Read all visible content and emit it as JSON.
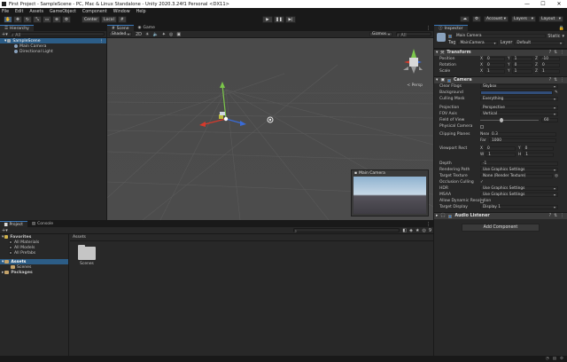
{
  "window": {
    "title": "First Project - SampleScene - PC, Mac & Linux Standalone - Unity 2020.3.24f1 Personal <DX11>",
    "minimize": "—",
    "maximize": "☐",
    "close": "✕"
  },
  "menu": [
    "File",
    "Edit",
    "Assets",
    "GameObject",
    "Component",
    "Window",
    "Help"
  ],
  "toolbar": {
    "pivot": "Center",
    "space": "Local",
    "account": "Account",
    "layers": "Layers",
    "layout": "Layout"
  },
  "hierarchy": {
    "tab": "Hierarchy",
    "search_placeholder": "All",
    "scene": "SampleScene",
    "items": [
      "Main Camera",
      "Directional Light"
    ]
  },
  "scene_view": {
    "tab_scene": "Scene",
    "tab_game": "Game",
    "shading": "Shaded",
    "mode_2d": "2D",
    "gizmos": "Gizmos",
    "search_placeholder": "All",
    "persp": "< Persp",
    "preview_title": "Main Camera"
  },
  "inspector": {
    "tab": "Inspector",
    "object_name": "Main Camera",
    "static": "Static",
    "tag_label": "Tag",
    "tag": "MainCamera",
    "layer_label": "Layer",
    "layer": "Default",
    "transform": {
      "title": "Transform",
      "position": {
        "label": "Position",
        "x": "0",
        "y": "1",
        "z": "-10"
      },
      "rotation": {
        "label": "Rotation",
        "x": "0",
        "y": "0",
        "z": "0"
      },
      "scale": {
        "label": "Scale",
        "x": "1",
        "y": "1",
        "z": "1"
      }
    },
    "camera": {
      "title": "Camera",
      "clear_flags": {
        "label": "Clear Flags",
        "value": "Skybox"
      },
      "background": {
        "label": "Background",
        "color": "#314d79"
      },
      "culling_mask": {
        "label": "Culling Mask",
        "value": "Everything"
      },
      "projection": {
        "label": "Projection",
        "value": "Perspective"
      },
      "fov_axis": {
        "label": "FOV Axis",
        "value": "Vertical"
      },
      "field_of_view": {
        "label": "Field of View",
        "value": "60"
      },
      "physical_camera": {
        "label": "Physical Camera"
      },
      "clipping_planes": {
        "label": "Clipping Planes",
        "near_label": "Near",
        "near": "0.3",
        "far_label": "Far",
        "far": "1000"
      },
      "viewport_rect": {
        "label": "Viewport Rect",
        "x": "0",
        "y": "0",
        "w": "1",
        "h": "1"
      },
      "depth": {
        "label": "Depth",
        "value": "-1"
      },
      "rendering_path": {
        "label": "Rendering Path",
        "value": "Use Graphics Settings"
      },
      "target_texture": {
        "label": "Target Texture",
        "value": "None (Render Texture)"
      },
      "occlusion_culling": {
        "label": "Occlusion Culling",
        "value": "✓"
      },
      "hdr": {
        "label": "HDR",
        "value": "Use Graphics Settings"
      },
      "msaa": {
        "label": "MSAA",
        "value": "Use Graphics Settings"
      },
      "allow_dynamic_resolution": {
        "label": "Allow Dynamic Resolution"
      },
      "target_display": {
        "label": "Target Display",
        "value": "Display 1"
      }
    },
    "audio_listener": {
      "title": "Audio Listener"
    },
    "add_component": "Add Component"
  },
  "project": {
    "tab_project": "Project",
    "tab_console": "Console",
    "count": "9",
    "favorites": {
      "title": "Favorites",
      "items": [
        "All Materials",
        "All Models",
        "All Prefabs"
      ]
    },
    "assets": {
      "title": "Assets",
      "items": [
        "Scenes"
      ]
    },
    "packages": "Packages",
    "breadcrumb": "Assets",
    "folder_label": "Scenes"
  }
}
